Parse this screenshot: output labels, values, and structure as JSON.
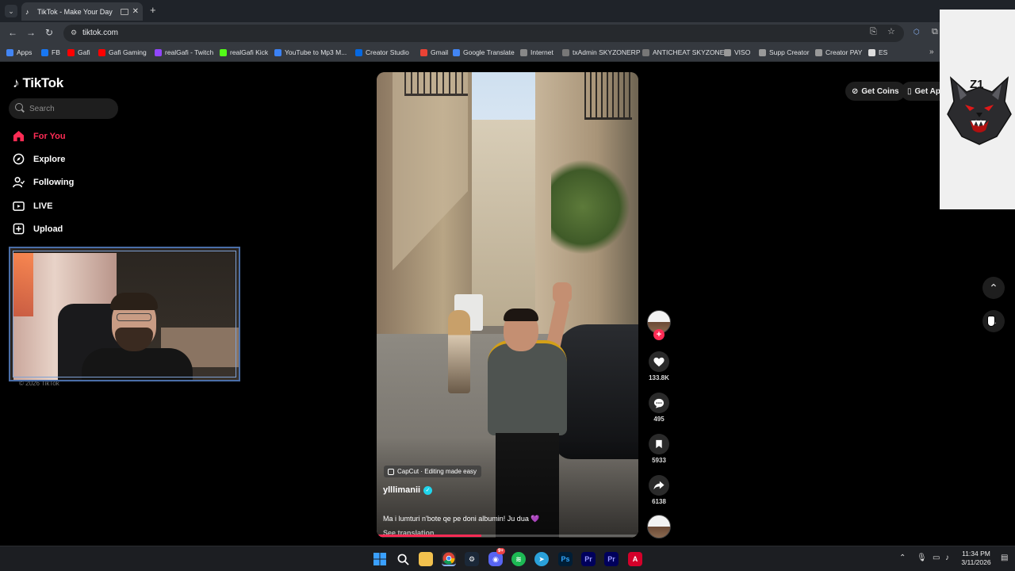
{
  "browser": {
    "tab_title": "TikTok - Make Your Day",
    "url": "tiktok.com",
    "bookmarks": [
      {
        "label": "Apps",
        "color": "#4285f4"
      },
      {
        "label": "FB",
        "color": "#1877f2"
      },
      {
        "label": "Gafi",
        "color": "#ff0000"
      },
      {
        "label": "Gafi Gaming",
        "color": "#ff0000"
      },
      {
        "label": "realGafi - Twitch",
        "color": "#9146ff"
      },
      {
        "label": "realGafi Kick",
        "color": "#53fc18"
      },
      {
        "label": "YouTube to Mp3 M...",
        "color": "#3b82f6"
      },
      {
        "label": "Creator Studio",
        "color": "#0668e1"
      },
      {
        "label": "Gmail",
        "color": "#ea4335"
      },
      {
        "label": "Google Translate",
        "color": "#4285f4"
      },
      {
        "label": "Internet",
        "color": "#888888"
      },
      {
        "label": "txAdmin SKYZONERP",
        "color": "#777777"
      },
      {
        "label": "ANTICHEAT SKYZONE",
        "color": "#777777"
      },
      {
        "label": "VISO",
        "color": "#999999"
      },
      {
        "label": "Supp Creator",
        "color": "#999999"
      },
      {
        "label": "Creator PAY",
        "color": "#999999"
      },
      {
        "label": "ES",
        "color": "#dddddd"
      }
    ]
  },
  "tiktok": {
    "logo_text": "TikTok",
    "search_placeholder": "Search",
    "nav": [
      {
        "label": "For You",
        "icon": "home-icon",
        "active": true
      },
      {
        "label": "Explore",
        "icon": "compass-icon",
        "active": false
      },
      {
        "label": "Following",
        "icon": "following-icon",
        "active": false
      },
      {
        "label": "LIVE",
        "icon": "live-icon",
        "active": false
      },
      {
        "label": "Upload",
        "icon": "upload-icon",
        "active": false
      }
    ],
    "copyright": "© 2026 TikTok",
    "get_coins": "Get Coins",
    "get_app": "Get Ap",
    "video": {
      "capcut_label": "CapCut · Editing made easy",
      "author": "ylllimanii",
      "caption": "Ma i lumturi n'bote qe pe doni albumin! Ju dua",
      "caption_emoji": "💜",
      "see_translation": "See translation",
      "progress": 0.4
    },
    "actions": {
      "likes": "133.8K",
      "comments": "495",
      "saves": "5933",
      "shares": "6138"
    }
  },
  "overlay": {
    "brand_text": "Z1"
  },
  "taskbar": {
    "time": "11:34 PM",
    "date": "3/11/2026",
    "discord_badge": "9+"
  }
}
